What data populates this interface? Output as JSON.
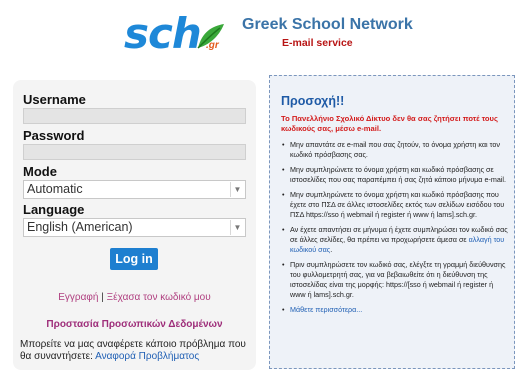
{
  "header": {
    "logo_text": "sch",
    "logo_sub": ".gr",
    "title": "Greek School Network",
    "subtitle": "E-mail service"
  },
  "login": {
    "username_label": "Username",
    "password_label": "Password",
    "mode_label": "Mode",
    "mode_value": "Automatic",
    "language_label": "Language",
    "language_value": "English (American)",
    "login_button": "Log in",
    "register_link": "Εγγραφή",
    "separator": "|",
    "forgot_link": "Ξέχασα τον κωδικό μου",
    "privacy_link": "Προστασία Προσωπικών Δεδομένων",
    "report_text": "Μπορείτε να μας αναφέρετε κάποιο πρόβλημα που θα συναντήσετε:",
    "report_link": "Αναφορά Προβλήματος"
  },
  "notice": {
    "title": "Προσοχή!!",
    "warning": "Το Πανελλήνιο Σχολικό Δίκτυο δεν θα σας ζητήσει ποτέ τους κωδικούς σας, μέσω e-mail.",
    "items": [
      "Μην απαντάτε σε e-mail που σας ζητούν, το όνομα χρήστη και τον κωδικό πρόσβασης σας.",
      "Μην συμπληρώνετε το όνομα χρήστη και κωδικό πρόσβασης σε ιστοσελίδες που σας παραπέμπει ή σας ζητά κάποιο μήνυμα e-mail.",
      "Μην συμπληρώνετε το όνομα χρήστη και κωδικό πρόσβασης που έχετε στο ΠΣΔ σε άλλες ιστοσελίδες εκτός των σελίδων εισόδου του ΠΣΔ https://sso ή webmail ή register ή www ή lams].sch.gr.",
      "Αν έχετε απαντήσει σε μήνυμα ή έχετε συμπληρώσει τον κωδικό σας σε άλλες σελίδες, θα πρέπει να προχωρήσετε άμεσα σε",
      "Πριν συμπληρώσετε τον κωδικό σας, ελέγξτε τη γραμμή διεύθυνσης του φυλλομετρητή σας, για να βεβαιωθείτε ότι η διεύθυνση της ιστοσελίδας είναι της μορφής: https://[sso ή webmail ή register ή www ή lams].sch.gr."
    ],
    "change_password_link": "αλλαγή του κωδικού σας",
    "learn_more": "Μάθετε περισσότερα...",
    "border_color": "#7b96bd"
  },
  "colors": {
    "brand_blue": "#1e88d8",
    "button_blue": "#1e7fd0",
    "warning_red": "#d31b1b",
    "link_purple": "#9e2e7a"
  }
}
